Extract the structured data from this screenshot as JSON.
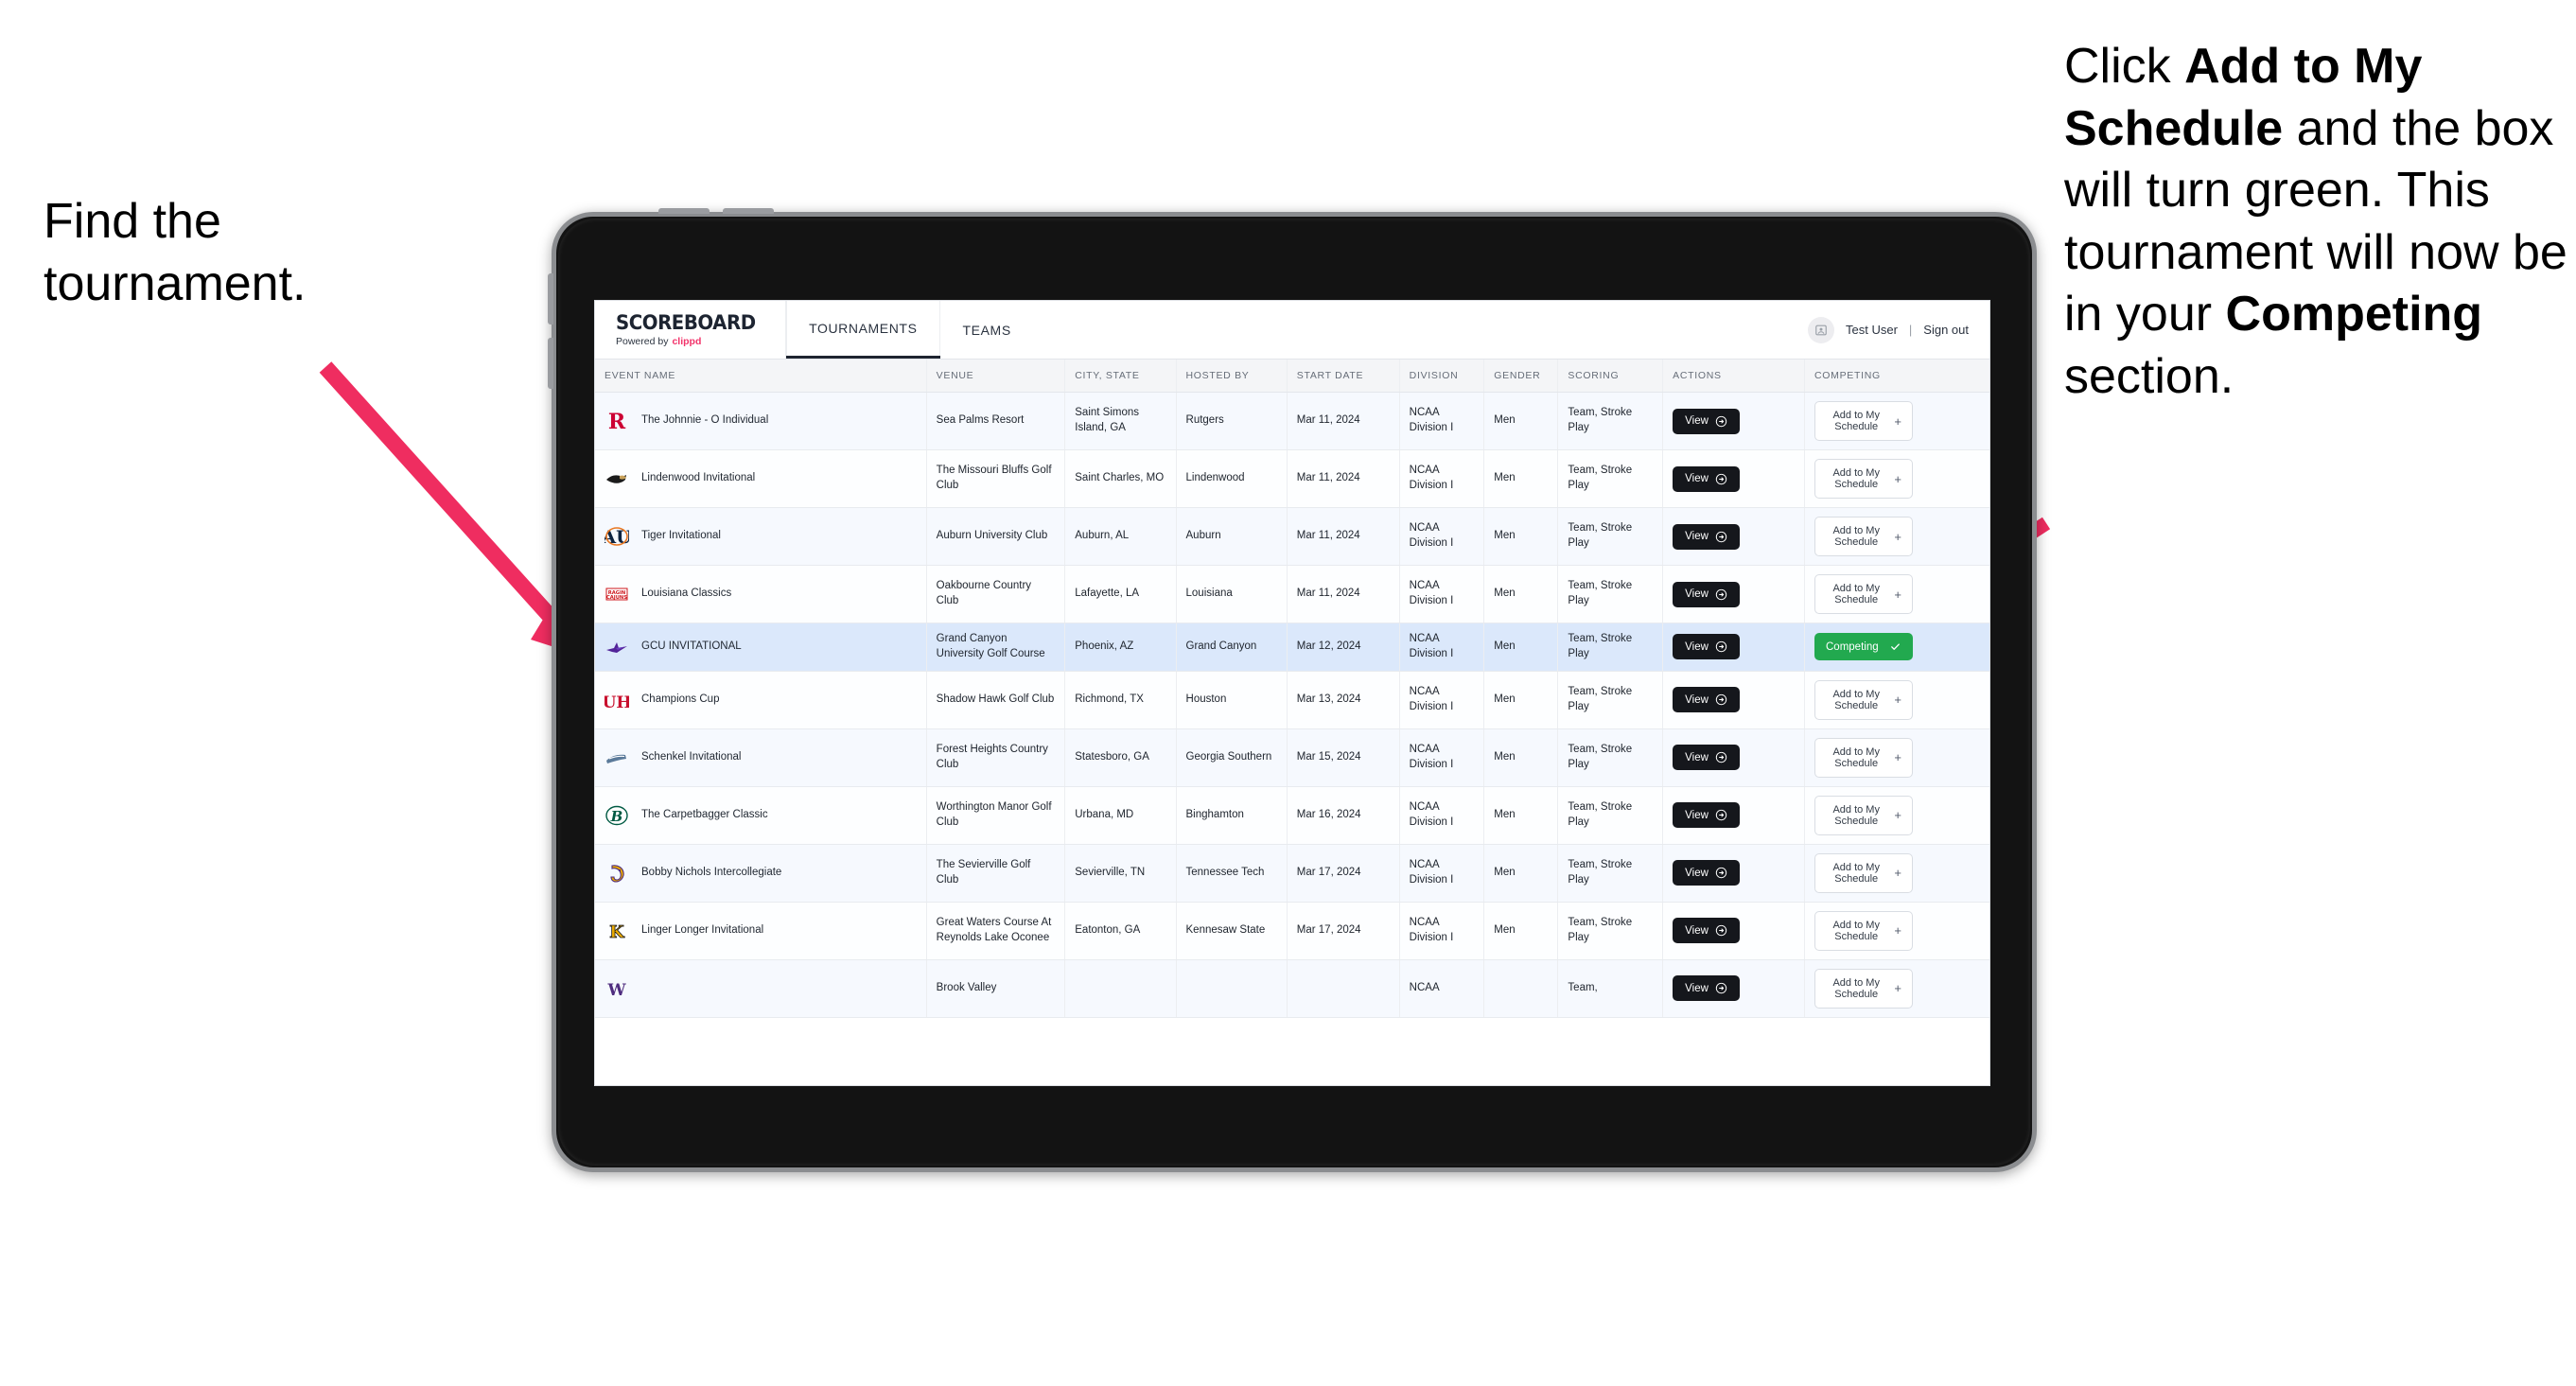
{
  "annotations": {
    "left": {
      "line1": "Find the",
      "line2": "tournament."
    },
    "right": {
      "pre": "Click ",
      "bold1": "Add to My Schedule",
      "mid": " and the box will turn green. This tournament will now be in your ",
      "bold2": "Competing",
      "post": " section."
    },
    "arrow_color": "#ef2d60"
  },
  "app": {
    "brand": {
      "name": "SCOREBOARD",
      "powered_prefix": "Powered by",
      "powered_brand": "clippd"
    },
    "tabs": [
      {
        "label": "TOURNAMENTS",
        "active": true
      },
      {
        "label": "TEAMS",
        "active": false
      }
    ],
    "account": {
      "user": "Test User",
      "separator": "|",
      "signout": "Sign out",
      "avatar_icon": "user-avatar-icon"
    }
  },
  "table": {
    "columns": [
      "EVENT NAME",
      "VENUE",
      "CITY, STATE",
      "HOSTED BY",
      "START DATE",
      "DIVISION",
      "GENDER",
      "SCORING",
      "ACTIONS",
      "COMPETING"
    ],
    "labels": {
      "view": "View",
      "add": "Add to My Schedule",
      "plus": "+",
      "competing": "Competing"
    },
    "rows": [
      {
        "logo": "rutgers-logo",
        "event": "The Johnnie - O Individual",
        "venue": "Sea Palms Resort",
        "city": "Saint Simons Island, GA",
        "host": "Rutgers",
        "date": "Mar 11, 2024",
        "division": "NCAA Division I",
        "gender": "Men",
        "scoring": "Team, Stroke Play",
        "state": "add",
        "selected": false
      },
      {
        "logo": "lindenwood-logo",
        "event": "Lindenwood Invitational",
        "venue": "The Missouri Bluffs Golf Club",
        "city": "Saint Charles, MO",
        "host": "Lindenwood",
        "date": "Mar 11, 2024",
        "division": "NCAA Division I",
        "gender": "Men",
        "scoring": "Team, Stroke Play",
        "state": "add",
        "selected": false
      },
      {
        "logo": "auburn-logo",
        "event": "Tiger Invitational",
        "venue": "Auburn University Club",
        "city": "Auburn, AL",
        "host": "Auburn",
        "date": "Mar 11, 2024",
        "division": "NCAA Division I",
        "gender": "Men",
        "scoring": "Team, Stroke Play",
        "state": "add",
        "selected": false
      },
      {
        "logo": "louisiana-logo",
        "event": "Louisiana Classics",
        "venue": "Oakbourne Country Club",
        "city": "Lafayette, LA",
        "host": "Louisiana",
        "date": "Mar 11, 2024",
        "division": "NCAA Division I",
        "gender": "Men",
        "scoring": "Team, Stroke Play",
        "state": "add",
        "selected": false
      },
      {
        "logo": "gcu-logo",
        "event": "GCU INVITATIONAL",
        "venue": "Grand Canyon University Golf Course",
        "city": "Phoenix, AZ",
        "host": "Grand Canyon",
        "date": "Mar 12, 2024",
        "division": "NCAA Division I",
        "gender": "Men",
        "scoring": "Team, Stroke Play",
        "state": "competing",
        "selected": true
      },
      {
        "logo": "houston-logo",
        "event": "Champions Cup",
        "venue": "Shadow Hawk Golf Club",
        "city": "Richmond, TX",
        "host": "Houston",
        "date": "Mar 13, 2024",
        "division": "NCAA Division I",
        "gender": "Men",
        "scoring": "Team, Stroke Play",
        "state": "add",
        "selected": false
      },
      {
        "logo": "georgia-southern-logo",
        "event": "Schenkel Invitational",
        "venue": "Forest Heights Country Club",
        "city": "Statesboro, GA",
        "host": "Georgia Southern",
        "date": "Mar 15, 2024",
        "division": "NCAA Division I",
        "gender": "Men",
        "scoring": "Team, Stroke Play",
        "state": "add",
        "selected": false
      },
      {
        "logo": "binghamton-logo",
        "event": "The Carpetbagger Classic",
        "venue": "Worthington Manor Golf Club",
        "city": "Urbana, MD",
        "host": "Binghamton",
        "date": "Mar 16, 2024",
        "division": "NCAA Division I",
        "gender": "Men",
        "scoring": "Team, Stroke Play",
        "state": "add",
        "selected": false
      },
      {
        "logo": "tennessee-tech-logo",
        "event": "Bobby Nichols Intercollegiate",
        "venue": "The Sevierville Golf Club",
        "city": "Sevierville, TN",
        "host": "Tennessee Tech",
        "date": "Mar 17, 2024",
        "division": "NCAA Division I",
        "gender": "Men",
        "scoring": "Team, Stroke Play",
        "state": "add",
        "selected": false
      },
      {
        "logo": "kennesaw-state-logo",
        "event": "Linger Longer Invitational",
        "venue": "Great Waters Course At Reynolds Lake Oconee",
        "city": "Eatonton, GA",
        "host": "Kennesaw State",
        "date": "Mar 17, 2024",
        "division": "NCAA Division I",
        "gender": "Men",
        "scoring": "Team, Stroke Play",
        "state": "add",
        "selected": false
      },
      {
        "logo": "partial-logo",
        "event": "",
        "venue": "Brook Valley",
        "city": "",
        "host": "",
        "date": "",
        "division": "NCAA",
        "gender": "",
        "scoring": "Team,",
        "state": "add",
        "selected": false
      }
    ]
  },
  "colors": {
    "competing_green": "#22a94f",
    "accent_pink": "#f2336a",
    "selected_row": "#dbe8fb",
    "dark_button": "#15171c"
  }
}
